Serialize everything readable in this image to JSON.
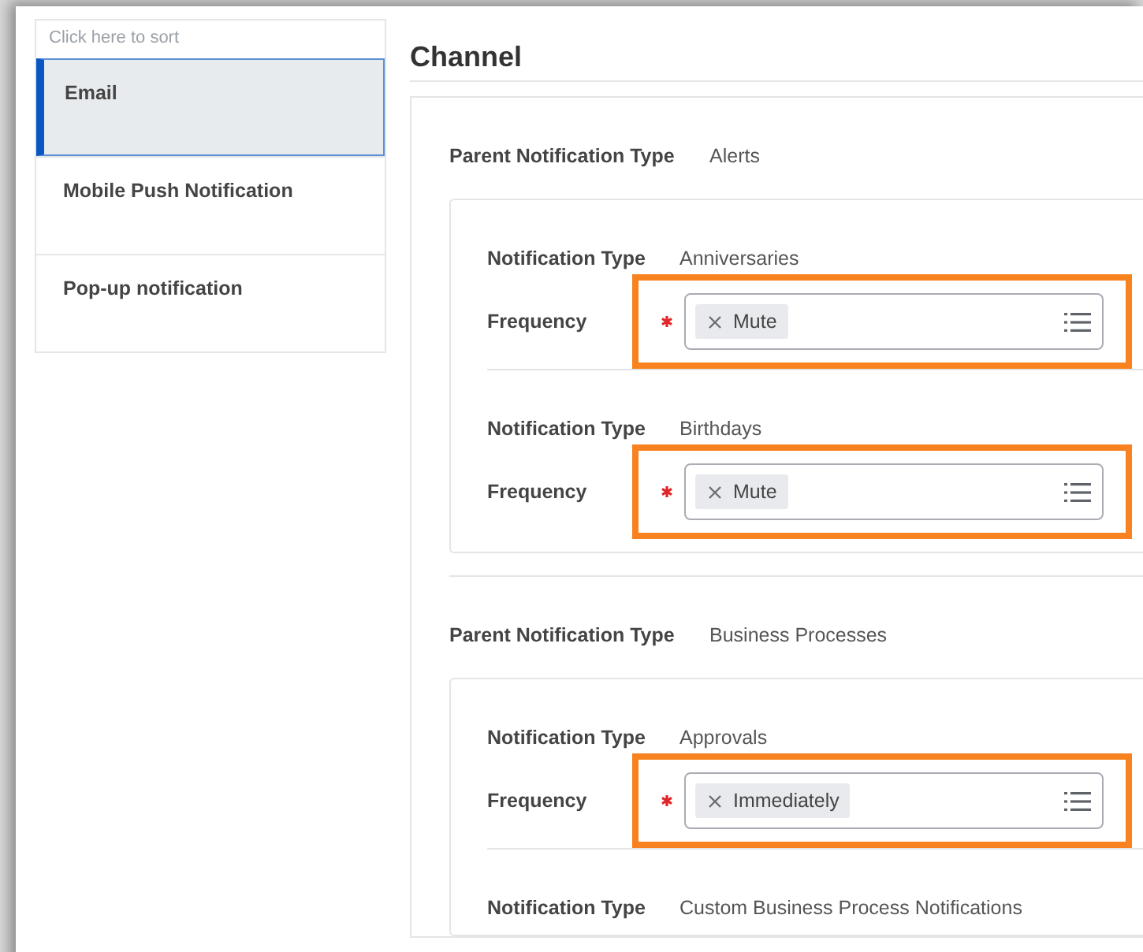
{
  "sidebar": {
    "sort_hint": "Click here to sort",
    "items": [
      {
        "label": "Email",
        "selected": true
      },
      {
        "label": "Mobile Push Notification",
        "selected": false
      },
      {
        "label": "Pop-up notification",
        "selected": false
      }
    ]
  },
  "heading": "Channel",
  "groups": [
    {
      "parent_label": "Parent Notification Type",
      "parent_value": "Alerts",
      "notifications": [
        {
          "type_label": "Notification Type",
          "type_value": "Anniversaries",
          "frequency_label": "Frequency",
          "required": true,
          "frequency": "Mute",
          "highlighted": true
        },
        {
          "type_label": "Notification Type",
          "type_value": "Birthdays",
          "frequency_label": "Frequency",
          "required": true,
          "frequency": "Mute",
          "highlighted": true
        }
      ]
    },
    {
      "parent_label": "Parent Notification Type",
      "parent_value": "Business Processes",
      "notifications": [
        {
          "type_label": "Notification Type",
          "type_value": "Approvals",
          "frequency_label": "Frequency",
          "required": true,
          "frequency": "Immediately",
          "highlighted": true
        },
        {
          "type_label": "Notification Type",
          "type_value": "Custom Business Process Notifications"
        }
      ]
    }
  ]
}
